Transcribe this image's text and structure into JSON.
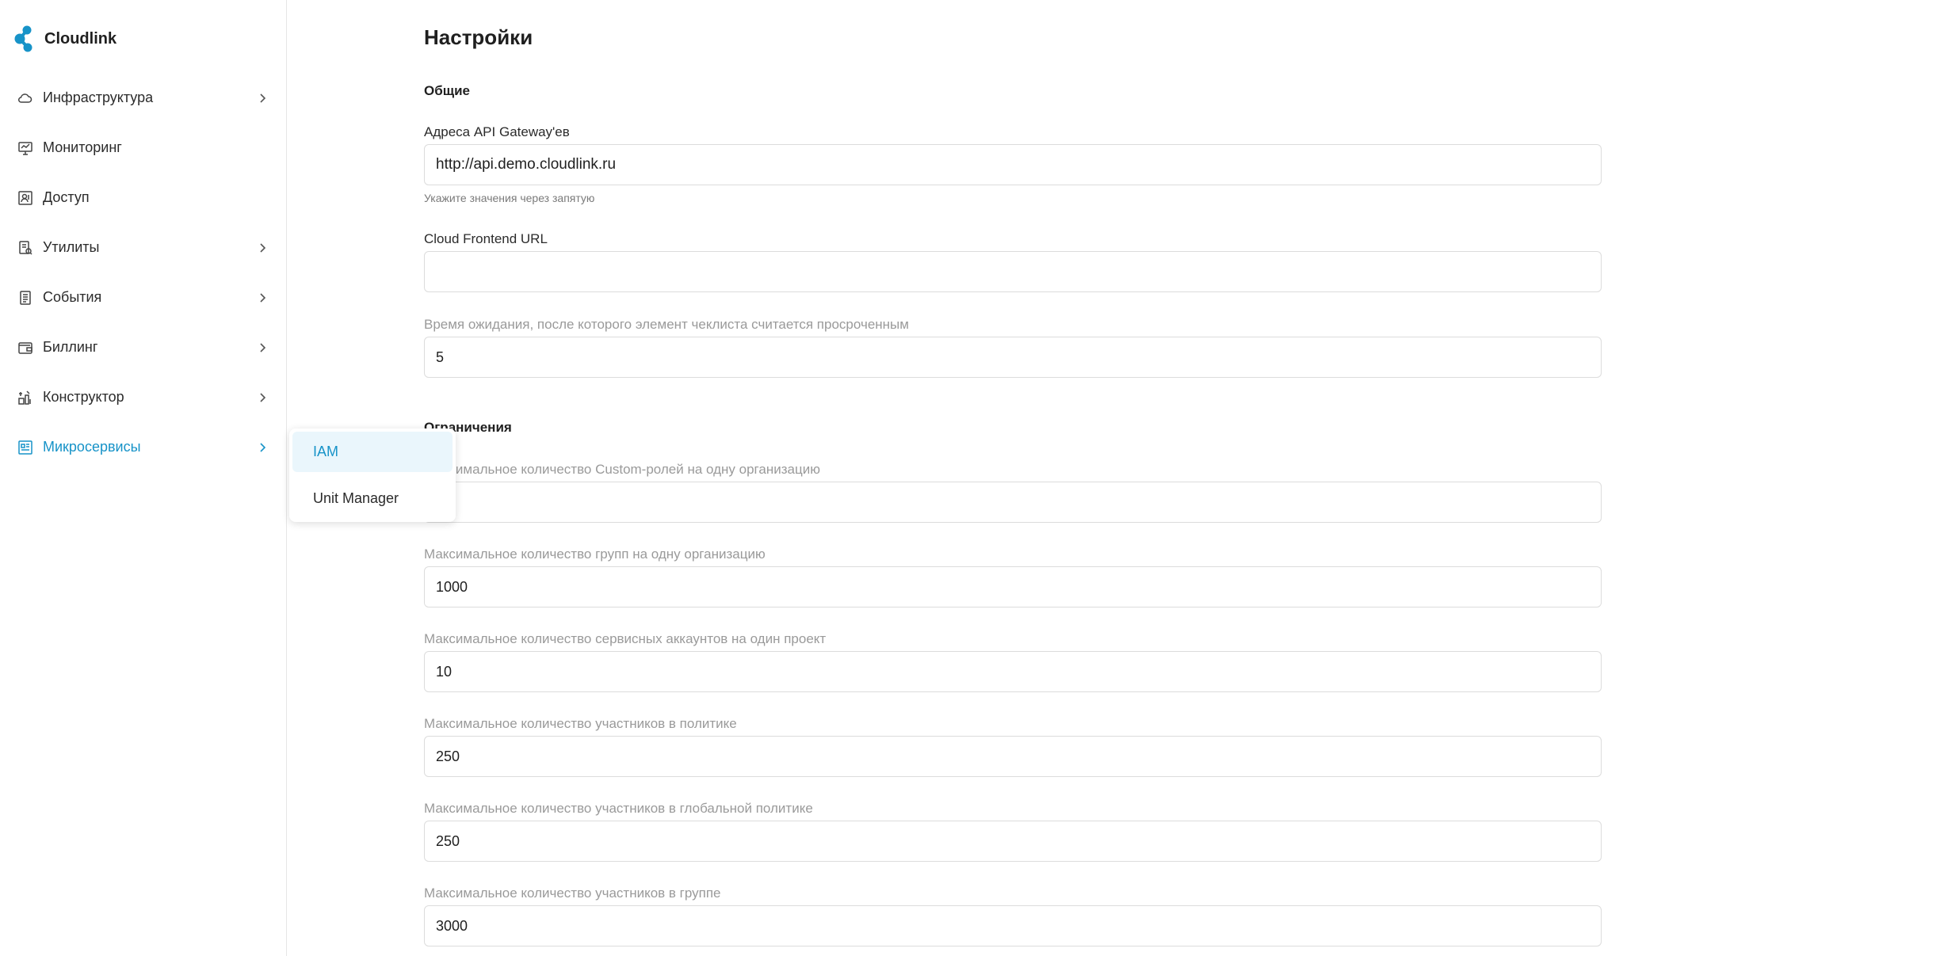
{
  "app": {
    "name": "Cloudlink",
    "accent": "#1793c8"
  },
  "sidebar": {
    "items": [
      {
        "label": "Инфраструктура",
        "icon": "cloud-icon",
        "has_chevron": true
      },
      {
        "label": "Мониторинг",
        "icon": "monitor-icon",
        "has_chevron": false
      },
      {
        "label": "Доступ",
        "icon": "access-icon",
        "has_chevron": false
      },
      {
        "label": "Утилиты",
        "icon": "tools-icon",
        "has_chevron": true
      },
      {
        "label": "События",
        "icon": "events-icon",
        "has_chevron": true
      },
      {
        "label": "Биллинг",
        "icon": "wallet-icon",
        "has_chevron": true
      },
      {
        "label": "Конструктор",
        "icon": "constructor-icon",
        "has_chevron": true
      },
      {
        "label": "Микросервисы",
        "icon": "microservices-icon",
        "has_chevron": true,
        "active": true
      }
    ]
  },
  "popup": {
    "items": [
      {
        "label": "IAM",
        "selected": true
      },
      {
        "label": "Unit Manager",
        "selected": false
      }
    ]
  },
  "main": {
    "title": "Настройки",
    "general": {
      "title": "Общие",
      "api_gateway": {
        "label": "Адреса API Gateway'ев",
        "value": "http://api.demo.cloudlink.ru",
        "hint": "Укажите значения через запятую"
      },
      "frontend_url": {
        "label": "Cloud Frontend URL",
        "value": ""
      },
      "checklist_timeout": {
        "label": "Время ожидания, после которого элемент чеклиста считается просроченным",
        "value": "5"
      }
    },
    "limits": {
      "title": "Ограничения",
      "custom_roles": {
        "label": "Максимальное количество Custom-ролей на одну организацию",
        "value": ""
      },
      "groups": {
        "label": "Максимальное количество групп на одну организацию",
        "value": "1000"
      },
      "service_accounts": {
        "label": "Максимальное количество сервисных аккаунтов на один проект",
        "value": "10"
      },
      "policy_members": {
        "label": "Максимальное количество участников в политике",
        "value": "250"
      },
      "global_policy_members": {
        "label": "Максимальное количество участников в глобальной политике",
        "value": "250"
      },
      "group_members": {
        "label": "Максимальное количество участников в группе",
        "value": "3000"
      }
    }
  }
}
